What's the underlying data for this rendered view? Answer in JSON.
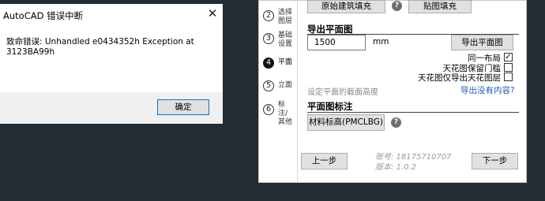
{
  "dialog": {
    "title": "AutoCAD 错误中断",
    "close_glyph": "✕",
    "message": "致命错误:  Unhandled e0434352h Exception at 3123BA99h",
    "ok_label": "确定"
  },
  "steps": [
    {
      "num": "2",
      "label_line1": "选择",
      "label_line2": "图层",
      "active": false
    },
    {
      "num": "3",
      "label_line1": "基础",
      "label_line2": "设置",
      "active": false
    },
    {
      "num": "4",
      "label_line1": "平面",
      "label_line2": "",
      "active": true
    },
    {
      "num": "5",
      "label_line1": "立面",
      "label_line2": "",
      "active": false
    },
    {
      "num": "6",
      "label_line1": "标注/",
      "label_line2": "其他",
      "active": false
    }
  ],
  "top_buttons": {
    "fill_original": "原始建筑填充",
    "fill_texture": "贴图填充"
  },
  "export_section": {
    "title": "导出平面图",
    "height_value": "1500",
    "unit": "mm",
    "export_button": "导出平面图",
    "checkboxes": [
      {
        "label": "同一布局",
        "checked": true
      },
      {
        "label": "天花图保留门槛",
        "checked": false
      },
      {
        "label": "天花图仅导出天花图层",
        "checked": false
      }
    ],
    "hint": "设定平面的截面高度",
    "link": "导出没有内容?"
  },
  "annotation_section": {
    "title": "平面图标注",
    "button": "材料标高(PMCLBG)"
  },
  "footer": {
    "prev": "上一步",
    "account": "账号: 18175710707",
    "version": "版本: 1.0.2",
    "next": "下一步"
  },
  "help_glyph": "?",
  "colors": {
    "link": "#1a5fb4",
    "background": "#232b33",
    "accent_border": "#0078d7"
  }
}
